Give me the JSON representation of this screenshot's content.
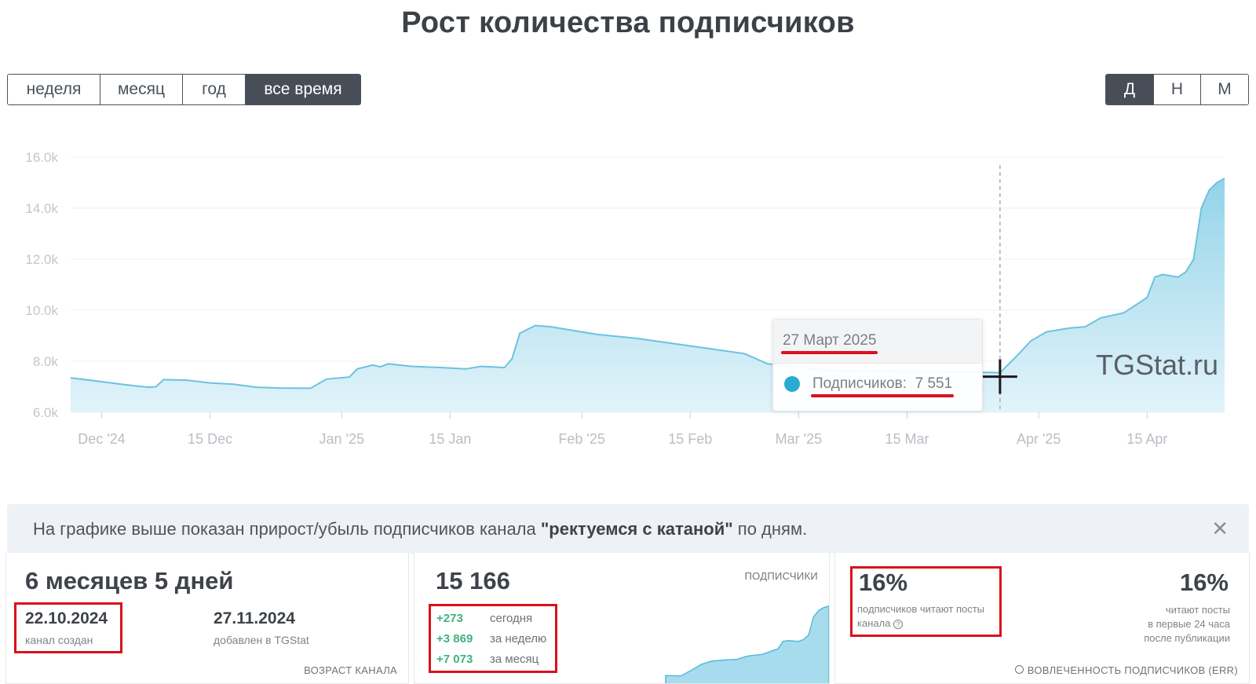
{
  "title": "Рост количества подписчиков",
  "range_tabs": [
    {
      "label": "неделя",
      "active": false
    },
    {
      "label": "месяц",
      "active": false
    },
    {
      "label": "год",
      "active": false
    },
    {
      "label": "все время",
      "active": true
    }
  ],
  "granularity_tabs": [
    {
      "label": "Д",
      "active": true
    },
    {
      "label": "Н",
      "active": false
    },
    {
      "label": "М",
      "active": false
    }
  ],
  "chart_data": {
    "type": "area",
    "x_ticks": [
      "Dec '24",
      "15 Dec",
      "Jan '25",
      "15 Jan",
      "Feb '25",
      "15 Feb",
      "Mar '25",
      "15 Mar",
      "Apr '25",
      "15 Apr"
    ],
    "y_ticks": [
      "6.0k",
      "8.0k",
      "10.0k",
      "12.0k",
      "14.0k",
      "16.0k"
    ],
    "ylim": [
      6000,
      16000
    ],
    "xlim": [
      "2024-11-27",
      "2025-04-25"
    ],
    "grid": true,
    "series": [
      {
        "color": "#6fc4e0",
        "points": [
          [
            "2024-11-27",
            7350
          ],
          [
            "2024-12-01",
            7200
          ],
          [
            "2024-12-04",
            7080
          ],
          [
            "2024-12-07",
            6980
          ],
          [
            "2024-12-08",
            7000
          ],
          [
            "2024-12-09",
            7280
          ],
          [
            "2024-12-12",
            7260
          ],
          [
            "2024-12-15",
            7150
          ],
          [
            "2024-12-18",
            7100
          ],
          [
            "2024-12-21",
            6980
          ],
          [
            "2024-12-24",
            6950
          ],
          [
            "2024-12-28",
            6940
          ],
          [
            "2024-12-30",
            7300
          ],
          [
            "2025-01-02",
            7380
          ],
          [
            "2025-01-03",
            7700
          ],
          [
            "2025-01-05",
            7850
          ],
          [
            "2025-01-06",
            7780
          ],
          [
            "2025-01-07",
            7900
          ],
          [
            "2025-01-10",
            7800
          ],
          [
            "2025-01-14",
            7750
          ],
          [
            "2025-01-17",
            7700
          ],
          [
            "2025-01-19",
            7800
          ],
          [
            "2025-01-22",
            7750
          ],
          [
            "2025-01-23",
            8100
          ],
          [
            "2025-01-24",
            9100
          ],
          [
            "2025-01-26",
            9400
          ],
          [
            "2025-01-28",
            9350
          ],
          [
            "2025-02-03",
            9050
          ],
          [
            "2025-02-08",
            8900
          ],
          [
            "2025-02-15",
            8600
          ],
          [
            "2025-02-22",
            8300
          ],
          [
            "2025-02-25",
            7900
          ],
          [
            "2025-02-28",
            7800
          ],
          [
            "2025-03-05",
            7650
          ],
          [
            "2025-03-10",
            7620
          ],
          [
            "2025-03-15",
            7600
          ],
          [
            "2025-03-20",
            7580
          ],
          [
            "2025-03-24",
            7570
          ],
          [
            "2025-03-27",
            7551
          ],
          [
            "2025-03-29",
            8150
          ],
          [
            "2025-03-31",
            8800
          ],
          [
            "2025-04-02",
            9150
          ],
          [
            "2025-04-05",
            9300
          ],
          [
            "2025-04-07",
            9350
          ],
          [
            "2025-04-09",
            9700
          ],
          [
            "2025-04-12",
            9900
          ],
          [
            "2025-04-14",
            10300
          ],
          [
            "2025-04-15",
            10500
          ],
          [
            "2025-04-16",
            11300
          ],
          [
            "2025-04-17",
            11400
          ],
          [
            "2025-04-19",
            11300
          ],
          [
            "2025-04-20",
            11500
          ],
          [
            "2025-04-21",
            12000
          ],
          [
            "2025-04-22",
            14000
          ],
          [
            "2025-04-23",
            14700
          ],
          [
            "2025-04-24",
            15000
          ],
          [
            "2025-04-25",
            15166
          ]
        ]
      }
    ],
    "crosshair_date": "2025-03-27",
    "watermark": "TGStat.ru",
    "tooltip": {
      "date": "27 Март 2025",
      "series_label": "Подписчиков:",
      "value": "7 551"
    }
  },
  "info_bar": {
    "prefix": "На графике выше показан прирост/убыль подписчиков канала ",
    "channel": "\"ректуемся с катаной\"",
    "suffix": " по дням.",
    "close_icon": "close-icon"
  },
  "age_card": {
    "age": "6 месяцев 5 дней",
    "created_date": "22.10.2024",
    "created_label": "канал создан",
    "added_date": "27.11.2024",
    "added_label": "добавлен в TGStat",
    "footer": "ВОЗРАСТ КАНАЛА"
  },
  "subs_card": {
    "total": "15 166",
    "label": "ПОДПИСЧИКИ",
    "deltas": [
      {
        "value": "+273",
        "label": "сегодня"
      },
      {
        "value": "+3 869",
        "label": "за неделю"
      },
      {
        "value": "+7 073",
        "label": "за месяц"
      }
    ],
    "spark_color": "#6fc4e0"
  },
  "err_card": {
    "left_value": "16%",
    "left_label": "подписчиков читают посты канала",
    "right_value": "16%",
    "right_label_1": "читают посты",
    "right_label_2": "в первые 24 часа",
    "right_label_3": "после публикации",
    "footer": "ВОВЛЕЧЕННОСТЬ ПОДПИСЧИКОВ (ERR)"
  }
}
